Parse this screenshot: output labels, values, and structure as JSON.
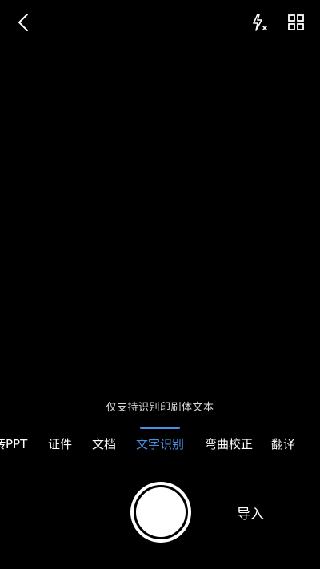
{
  "top_bar": {
    "back_icon": "chevron-left-icon",
    "flash_icon": "flash-off-icon",
    "layout_icon": "grid-layout-icon"
  },
  "hint": "仅支持识别印刷体文本",
  "modes": [
    {
      "label": "转PPT",
      "active": false
    },
    {
      "label": "证件",
      "active": false
    },
    {
      "label": "文档",
      "active": false
    },
    {
      "label": "文字识别",
      "active": true
    },
    {
      "label": "弯曲校正",
      "active": false
    },
    {
      "label": "翻译",
      "active": false
    }
  ],
  "capture": {
    "shutter_icon": "shutter-icon",
    "import_label": "导入"
  },
  "colors": {
    "background": "#000000",
    "accent": "#4a90e2",
    "text": "#ffffff",
    "hint_text": "#d9d9d9"
  }
}
